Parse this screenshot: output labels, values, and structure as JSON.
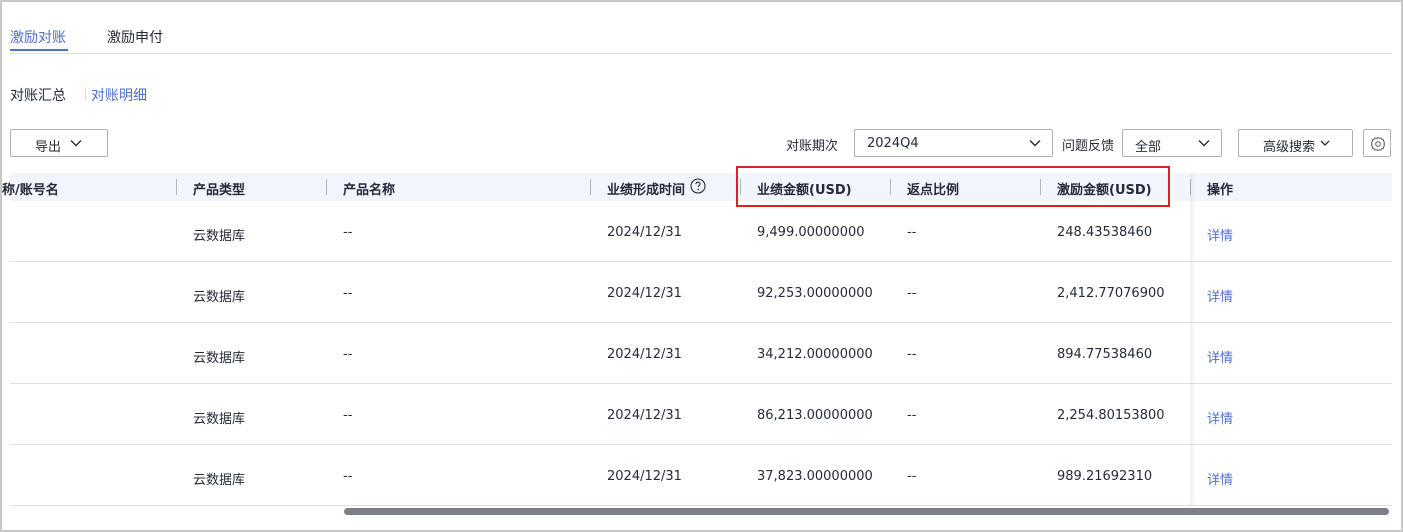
{
  "tabs": [
    {
      "label": "激励对账",
      "active": true
    },
    {
      "label": "激励申付",
      "active": false
    }
  ],
  "subtabs": [
    {
      "label": "对账汇总",
      "active": false
    },
    {
      "label": "对账明细",
      "active": true
    }
  ],
  "toolbar": {
    "export_label": "导出",
    "period_label": "对账期次",
    "period_value": "2024Q4",
    "issue_label": "问题反馈",
    "issue_value": "全部",
    "advanced_search_label": "高级搜索"
  },
  "table": {
    "columns": [
      "称/账号名",
      "产品类型",
      "产品名称",
      "业绩形成时间",
      "业绩金额(USD)",
      "返点比例",
      "激励金额(USD)",
      "操作"
    ],
    "rows": [
      {
        "product_type": "云数据库",
        "product_name": "--",
        "time": "2024/12/31",
        "perf_amount": "9,499.00000000",
        "rebate": "--",
        "incentive": "248.43538460",
        "action": "详情"
      },
      {
        "product_type": "云数据库",
        "product_name": "--",
        "time": "2024/12/31",
        "perf_amount": "92,253.00000000",
        "rebate": "--",
        "incentive": "2,412.77076900",
        "action": "详情"
      },
      {
        "product_type": "云数据库",
        "product_name": "--",
        "time": "2024/12/31",
        "perf_amount": "34,212.00000000",
        "rebate": "--",
        "incentive": "894.77538460",
        "action": "详情"
      },
      {
        "product_type": "云数据库",
        "product_name": "--",
        "time": "2024/12/31",
        "perf_amount": "86,213.00000000",
        "rebate": "--",
        "incentive": "2,254.80153800",
        "action": "详情"
      },
      {
        "product_type": "云数据库",
        "product_name": "--",
        "time": "2024/12/31",
        "perf_amount": "37,823.00000000",
        "rebate": "--",
        "incentive": "989.21692310",
        "action": "详情"
      }
    ]
  },
  "colors": {
    "accent": "#526ecc",
    "highlight_box": "#e02020",
    "header_bg": "#f2f5fc"
  },
  "icons": {
    "export_chevron": "chevron-down-icon",
    "help": "question-circle-icon",
    "settings": "gear-icon"
  }
}
